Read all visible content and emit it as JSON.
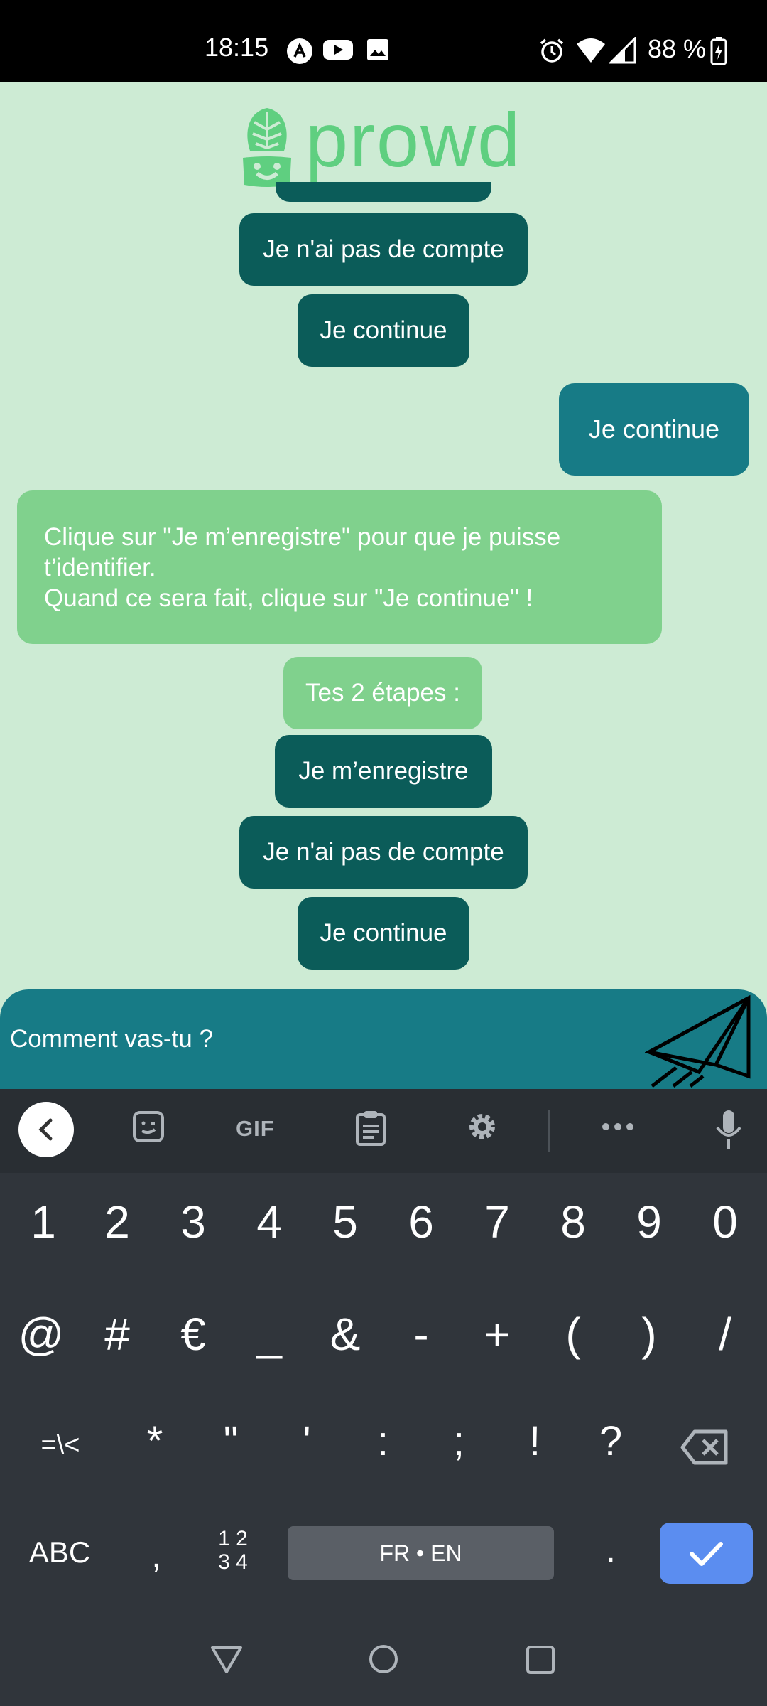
{
  "status_bar": {
    "time": "18:15",
    "battery": "88 %"
  },
  "app": {
    "logo_text": "prowd"
  },
  "chat": {
    "top_options": {
      "no_account": "Je n'ai pas de compte",
      "continue": "Je continue"
    },
    "user_message": "Je continue",
    "bot_message": {
      "line1": "Clique sur \"Je m’enregistre\" pour que je puisse",
      "line2": "t’identifier.",
      "line3": "Quand ce sera fait, clique sur \"Je continue\" !"
    },
    "steps_label": "Tes 2 étapes :",
    "options": {
      "register": "Je m’enregistre",
      "no_account": "Je n'ai pas de compte",
      "continue": "Je continue"
    }
  },
  "input": {
    "value": "Comment vas-tu ?"
  },
  "keyboard": {
    "toolbar": {
      "gif": "GIF"
    },
    "row1": [
      "1",
      "2",
      "3",
      "4",
      "5",
      "6",
      "7",
      "8",
      "9",
      "0"
    ],
    "row2": [
      "@",
      "#",
      "€",
      "_",
      "&",
      "-",
      "+",
      "(",
      ")",
      "/"
    ],
    "row3": [
      "=\\<",
      "*",
      "\"",
      "'",
      ":",
      ";",
      "!",
      "?"
    ],
    "row4": {
      "abc": "ABC",
      "comma": ",",
      "numpad_top": "1 2",
      "numpad_bottom": "3 4",
      "space": "FR • EN",
      "period": "."
    }
  },
  "colors": {
    "background": "#cdebd4",
    "dark_button": "#0b5c59",
    "user_bubble": "#177b86",
    "bot_bubble": "#80d18d",
    "logo": "#5fcf80",
    "enter_key": "#5b8df0"
  }
}
